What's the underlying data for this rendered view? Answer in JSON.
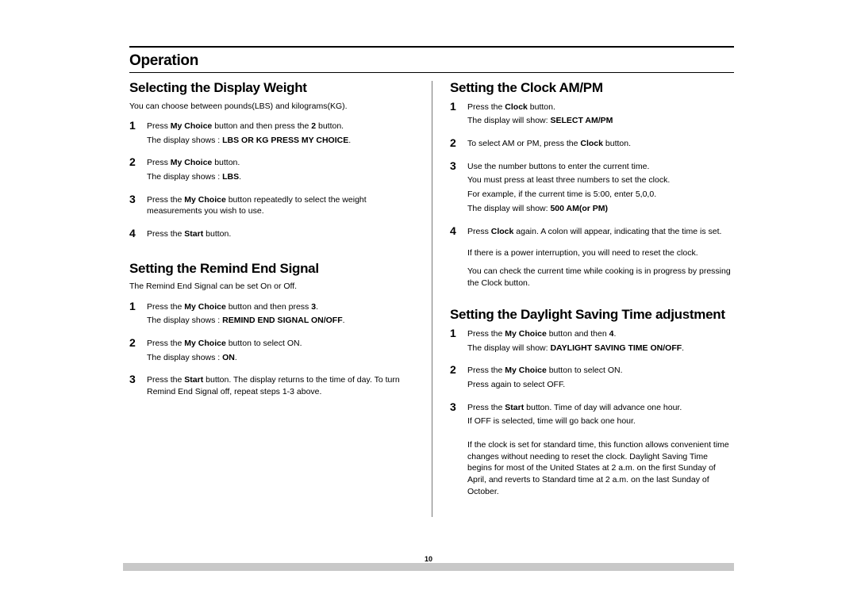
{
  "page_number": "10",
  "section_title": "Operation",
  "left": {
    "s1": {
      "title": "Selecting the Display Weight",
      "intro": "You can choose between pounds(LBS) and kilograms(KG).",
      "steps": {
        "1a": "Press ",
        "1b": "My Choice",
        "1c": " button and then press the ",
        "1d": "2",
        "1e": " button.",
        "1f": "The display shows : ",
        "1g": "LBS OR KG PRESS MY CHOICE",
        "1h": ".",
        "2a": "Press ",
        "2b": "My Choice",
        "2c": " button.",
        "2d": "The display shows : ",
        "2e": "LBS",
        "2f": ".",
        "3a": "Press the ",
        "3b": "My Choice",
        "3c": " button repeatedly to select the weight measurements you wish to use.",
        "4a": "Press the ",
        "4b": "Start",
        "4c": " button."
      }
    },
    "s2": {
      "title": "Setting the Remind End Signal",
      "intro": "The Remind End Signal can be set On or Off.",
      "steps": {
        "1a": "Press the ",
        "1b": "My Choice",
        "1c": " button and then press ",
        "1d": "3",
        "1e": ".",
        "1f": "The display shows : ",
        "1g": "REMIND END SIGNAL ON/OFF",
        "1h": ".",
        "2a": "Press the ",
        "2b": "My Choice",
        "2c": " button to select ON.",
        "2d": "The display shows : ",
        "2e": "ON",
        "2f": ".",
        "3a": "Press the ",
        "3b": "Start",
        "3c": " button. The display returns to the time of day. To turn Remind End Signal off, repeat steps 1-3 above."
      }
    }
  },
  "right": {
    "s1": {
      "title": "Setting the Clock AM/PM",
      "steps": {
        "1a": "Press the ",
        "1b": "Clock",
        "1c": " button.",
        "1d": "The display will show: ",
        "1e": "SELECT AM/PM",
        "2a": "To select AM or PM, press the ",
        "2b": "Clock",
        "2c": " button.",
        "3a": "Use the number buttons to enter the current time.",
        "3b": "You must press at least three numbers to set the clock.",
        "3c": "For example, if the current time is 5:00, enter 5,0,0.",
        "3d": "The display will show: ",
        "3e": "500 AM(or PM)",
        "4a": "Press ",
        "4b": "Clock",
        "4c": " again. A colon will appear, indicating that the time is set."
      },
      "extra1": "If there is a power interruption, you will need to reset the clock.",
      "extra2": "You can check the current time while cooking is in progress by pressing the Clock  button."
    },
    "s2": {
      "title": "Setting the Daylight Saving Time adjustment",
      "steps": {
        "1a": "Press the ",
        "1b": "My Choice",
        "1c": " button and then ",
        "1d": "4",
        "1e": ".",
        "1f": "The display will show: ",
        "1g": "DAYLIGHT SAVING TIME ON/OFF",
        "1h": ".",
        "2a": "Press the ",
        "2b": "My Choice",
        "2c": " button to select ON.",
        "2d": "Press again to select OFF.",
        "3a": "Press the ",
        "3b": "Start",
        "3c": " button. Time of day will advance one hour.",
        "3d": "If OFF is selected, time will go back one hour."
      },
      "extra": "If the clock is set for standard time, this function allows convenient time changes without needing to reset the clock. Daylight Saving Time begins for most of the United States at 2 a.m. on the first Sunday of April, and reverts to Standard time at 2 a.m. on the last Sunday of October."
    }
  }
}
